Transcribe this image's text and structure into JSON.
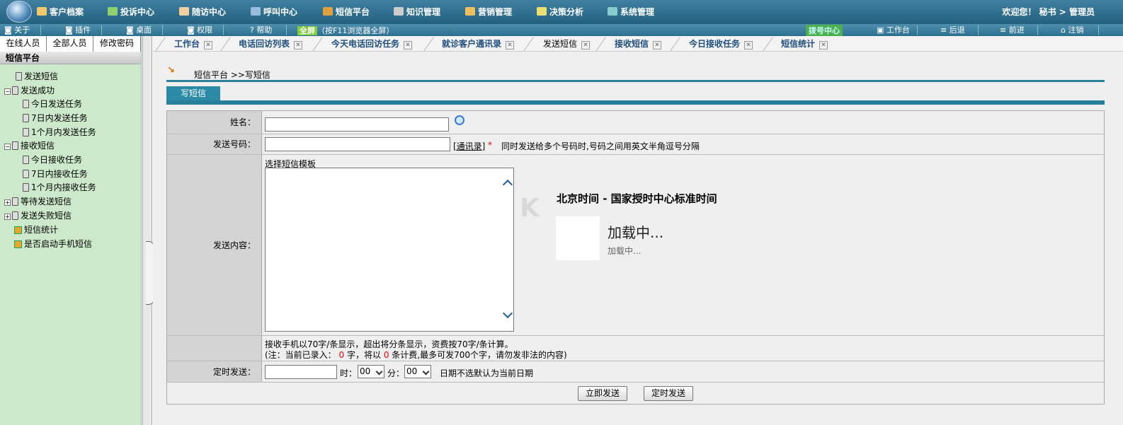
{
  "topbar": {
    "menus": [
      "客户档案",
      "投诉中心",
      "随访中心",
      "呼叫中心",
      "短信平台",
      "知识管理",
      "营销管理",
      "决策分析",
      "系统管理"
    ],
    "welcome": "欢迎您！  秘书  > 管理员"
  },
  "toolbar": {
    "about": "关于",
    "plugin": "插件",
    "desktop": "桌面",
    "permission": "权限",
    "help": "帮助",
    "fullscreen_label": "全屏",
    "fullscreen_hint": "（按F11浏览器全屏）",
    "dial_center": "拨号中心",
    "workbench": "工作台",
    "back": "后退",
    "forward": "前进",
    "logout": "注销"
  },
  "sidebar": {
    "tabs": [
      "在线人员",
      "全部人员",
      "修改密码"
    ],
    "root": "短信平台",
    "items": [
      "发送短信",
      "发送成功",
      "今日发送任务",
      "7日内发送任务",
      "1个月内发送任务",
      "接收短信",
      "今日接收任务",
      "7日内接收任务",
      "1个月内接收任务",
      "等待发送短信",
      "发送失败短信",
      "短信统计",
      "是否启动手机短信"
    ]
  },
  "tabs": [
    "工作台",
    "电话回访列表",
    "今天电话回访任务",
    "就诊客户通讯录",
    "发送短信",
    "接收短信",
    "今日接收任务",
    "短信统计"
  ],
  "breadcrumb": "短信平台 >>写短信",
  "section_tab": "写短信",
  "form": {
    "name_label": "姓名：",
    "number_label": "发送号码：",
    "contacts_link": "[通讯录]",
    "required_mark": "*",
    "number_hint": "同时发送给多个号码时,号码之间用英文半角逗号分隔",
    "template_link": "选择短信模板",
    "content_label": "发送内容：",
    "note1": "接收手机以70字/条显示，超出将分条显示，资费按70字/条计算。",
    "note2_a": "(注：当前已录入：",
    "note2_count": "0",
    "note2_b": "字，将以",
    "note2_msgs": "0",
    "note2_c": "条计费,最多可发700个字，请勿发非法的内容)",
    "timed_label": "定时发送：",
    "hour_label": "时：",
    "hour_value": "00",
    "minute_label": "分：",
    "minute_value": "00",
    "date_hint": "日期不选默认为当前日期",
    "send_now": "立即发送",
    "send_timed": "定时发送"
  },
  "clock": {
    "title": "北京时间 - 国家授时中心标准时间",
    "loading": "加载中...",
    "loading_sub": "加载中..."
  },
  "colors": {
    "topbar": "#2e6f8e",
    "sidebar": "#cde9cb",
    "accent": "#2a7f9a",
    "tab_text": "#1e4e7e"
  }
}
